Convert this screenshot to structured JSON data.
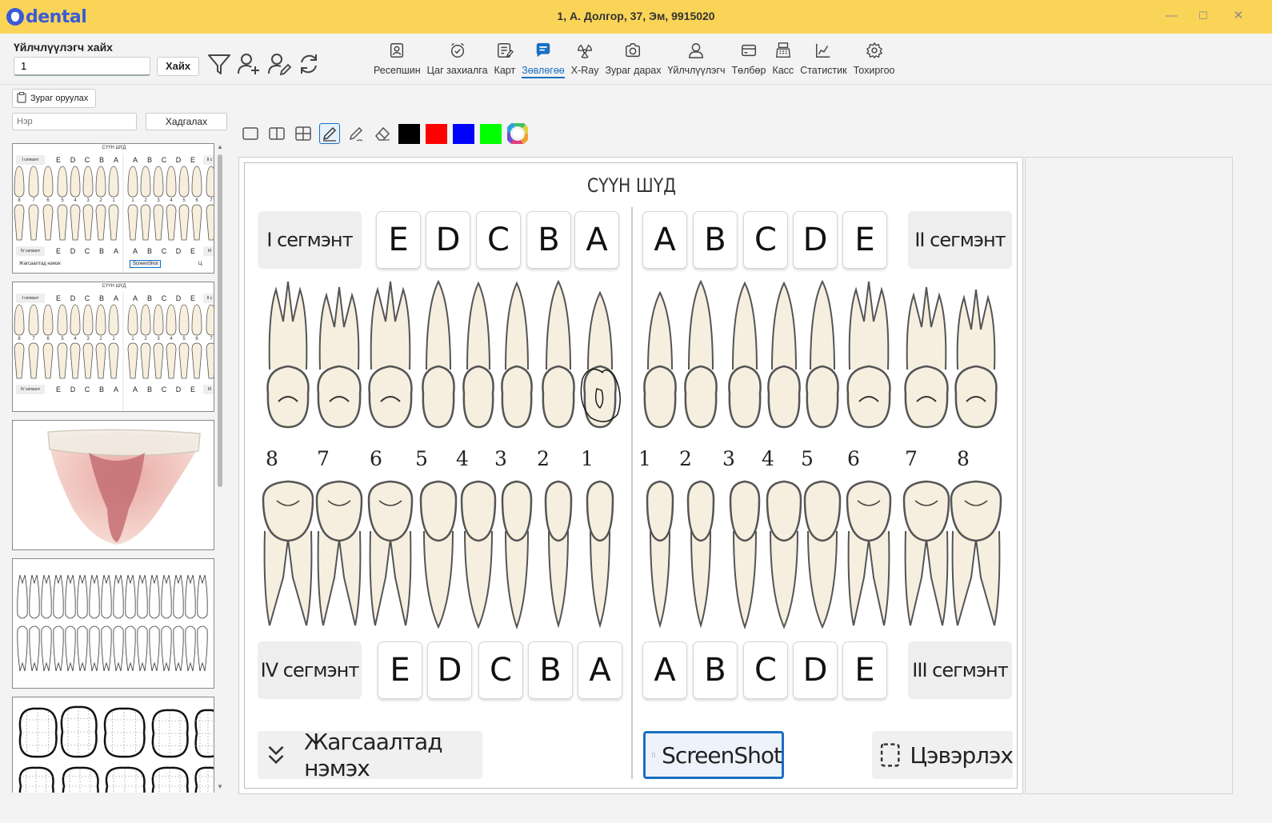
{
  "app": {
    "logo_text": "dental",
    "window_title": "1, А. Долгор, 37, Эм, 9915020"
  },
  "window_controls": {
    "minimize": "—",
    "maximize": "☐",
    "close": "✕"
  },
  "search": {
    "label": "Үйлчлүүлэгч хайх",
    "value": "1",
    "button": "Хайх"
  },
  "nav": [
    {
      "label": "Ресепшин",
      "icon": "reception-icon",
      "active": false
    },
    {
      "label": "Цаг захиалга",
      "icon": "alarm-clock-icon",
      "active": false
    },
    {
      "label": "Карт",
      "icon": "card-note-icon",
      "active": false
    },
    {
      "label": "Зөвлөгөө",
      "icon": "chat-icon",
      "active": true
    },
    {
      "label": "X-Ray",
      "icon": "radiation-icon",
      "active": false
    },
    {
      "label": "Зураг дарах",
      "icon": "camera-icon",
      "active": false
    },
    {
      "label": "Үйлчлүүлэгч",
      "icon": "user-icon",
      "active": false
    },
    {
      "label": "Төлбөр",
      "icon": "payment-icon",
      "active": false
    },
    {
      "label": "Касс",
      "icon": "cash-register-icon",
      "active": false
    },
    {
      "label": "Статистик",
      "icon": "chart-icon",
      "active": false
    },
    {
      "label": "Тохиргоо",
      "icon": "gear-icon",
      "active": false
    }
  ],
  "left": {
    "upload_label": "Зураг оруулах",
    "name_placeholder": "Нэр",
    "save_label": "Хадгалах",
    "thumbnails": [
      {
        "title": "СҮҮН ШҮД",
        "kind": "baby-teeth-chart"
      },
      {
        "title": "СҮҮН ШҮД",
        "kind": "baby-teeth-chart"
      },
      {
        "kind": "tooth-cross-section"
      },
      {
        "kind": "full-dentition-outline"
      },
      {
        "kind": "tooth-grid-outline"
      }
    ],
    "thumb_small": {
      "seg1": "I сегмэнт",
      "seg2": "II с",
      "seg3": "III",
      "seg4": "IV сегмэнт",
      "add_label": "Жагсаалтад нэмэх",
      "screenshot_label": "ScreenShot",
      "clear_label": "Ц"
    }
  },
  "draw_tools": {
    "colors": [
      "#000000",
      "#ff0000",
      "#0000ff",
      "#00ff00"
    ],
    "selected_tool": "pen"
  },
  "chart": {
    "title": "СҮҮН ШҮД",
    "seg1": "I сегмэнт",
    "seg2": "II сегмэнт",
    "seg3": "III сегмэнт",
    "seg4": "IV сегмэнт",
    "upper_left_letters": [
      "E",
      "D",
      "C",
      "B",
      "A"
    ],
    "upper_right_letters": [
      "A",
      "B",
      "C",
      "D",
      "E"
    ],
    "lower_left_letters": [
      "E",
      "D",
      "C",
      "B",
      "A"
    ],
    "lower_right_letters": [
      "A",
      "B",
      "C",
      "D",
      "E"
    ],
    "numbers_left": [
      "8",
      "7",
      "6",
      "5",
      "4",
      "3",
      "2",
      "1"
    ],
    "numbers_right": [
      "1",
      "2",
      "3",
      "4",
      "5",
      "6",
      "7",
      "8"
    ],
    "add_button": "Жагсаалтад нэмэх",
    "screenshot_button": "ScreenShot",
    "clear_button": "Цэвэрлэх"
  }
}
